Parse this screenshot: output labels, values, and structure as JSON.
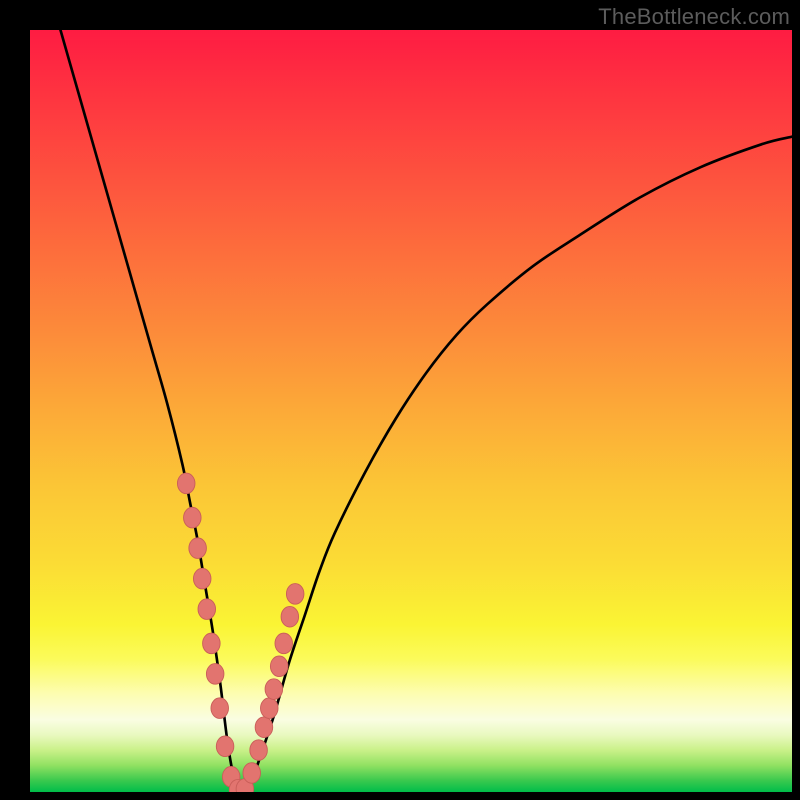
{
  "watermark": "TheBottleneck.com",
  "colors": {
    "frame": "#000000",
    "curve_stroke": "#000000",
    "marker_fill": "#e2746f",
    "marker_stroke": "#c95e59"
  },
  "gradient_stops": [
    {
      "offset": 0.0,
      "color": "#fe1c42"
    },
    {
      "offset": 0.1,
      "color": "#fe3840"
    },
    {
      "offset": 0.2,
      "color": "#fd543e"
    },
    {
      "offset": 0.3,
      "color": "#fd703c"
    },
    {
      "offset": 0.4,
      "color": "#fc8c3a"
    },
    {
      "offset": 0.5,
      "color": "#fcaa38"
    },
    {
      "offset": 0.6,
      "color": "#fbc636"
    },
    {
      "offset": 0.7,
      "color": "#fbdc35"
    },
    {
      "offset": 0.78,
      "color": "#faf434"
    },
    {
      "offset": 0.825,
      "color": "#fbfb5a"
    },
    {
      "offset": 0.87,
      "color": "#fdfdaf"
    },
    {
      "offset": 0.905,
      "color": "#fafde2"
    },
    {
      "offset": 0.925,
      "color": "#e9f9c0"
    },
    {
      "offset": 0.945,
      "color": "#caf189"
    },
    {
      "offset": 0.965,
      "color": "#91e162"
    },
    {
      "offset": 0.985,
      "color": "#3ac94e"
    },
    {
      "offset": 1.0,
      "color": "#00bd4a"
    }
  ],
  "chart_data": {
    "type": "line",
    "title": "",
    "xlabel": "",
    "ylabel": "",
    "xlim": [
      0,
      100
    ],
    "ylim": [
      0,
      100
    ],
    "series": [
      {
        "name": "bottleneck-curve",
        "x": [
          4,
          6,
          8,
          10,
          12,
          14,
          16,
          18,
          20,
          21,
          22,
          23,
          24,
          25,
          26,
          27,
          28,
          29,
          30,
          32,
          34,
          36,
          38,
          40,
          44,
          48,
          52,
          56,
          60,
          66,
          72,
          80,
          88,
          96,
          100
        ],
        "y": [
          100,
          93,
          86,
          79,
          72,
          65,
          58,
          51,
          43,
          38,
          33,
          27,
          21,
          14,
          6,
          1,
          0,
          1,
          4,
          10,
          17,
          23,
          29,
          34,
          42,
          49,
          55,
          60,
          64,
          69,
          73,
          78,
          82,
          85,
          86
        ]
      }
    ],
    "markers": {
      "name": "highlight-dots",
      "x": [
        20.5,
        21.3,
        22.0,
        22.6,
        23.2,
        23.8,
        24.3,
        24.9,
        25.6,
        26.4,
        27.3,
        28.2,
        29.1,
        30.0,
        30.7,
        31.4,
        32.0,
        32.7,
        33.3,
        34.1,
        34.8
      ],
      "y": [
        40.5,
        36.0,
        32.0,
        28.0,
        24.0,
        19.5,
        15.5,
        11.0,
        6.0,
        2.0,
        0.3,
        0.4,
        2.5,
        5.5,
        8.5,
        11.0,
        13.5,
        16.5,
        19.5,
        23.0,
        26.0
      ]
    }
  }
}
